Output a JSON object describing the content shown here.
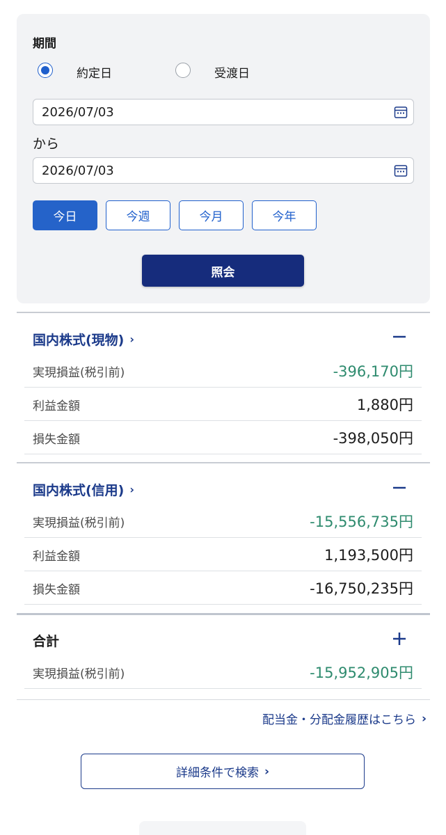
{
  "filter": {
    "period_label": "期間",
    "radio_trade_date": "約定日",
    "radio_delivery_date": "受渡日",
    "date_from": "2026/07/03",
    "kara": "から",
    "date_to": "2026/07/03",
    "quick_today": "今日",
    "quick_week": "今週",
    "quick_month": "今月",
    "quick_year": "今年",
    "submit": "照会"
  },
  "sections": [
    {
      "title": "国内株式(現物)",
      "chevron": "›",
      "rows": [
        {
          "label": "実現損益(税引前)",
          "value": "-396,170円"
        },
        {
          "label": "利益金額",
          "value": "1,880円"
        },
        {
          "label": "損失金額",
          "value": "-398,050円"
        }
      ]
    },
    {
      "title": "国内株式(信用)",
      "chevron": "›",
      "rows": [
        {
          "label": "実現損益(税引前)",
          "value": "-15,556,735円"
        },
        {
          "label": "利益金額",
          "value": "1,193,500円"
        },
        {
          "label": "損失金額",
          "value": "-16,750,235円"
        }
      ]
    },
    {
      "title": "合計",
      "rows": [
        {
          "label": "実現損益(税引前)",
          "value": "-15,952,905円"
        }
      ]
    }
  ],
  "links": {
    "dividend_history": "配当金・分配金履歴はこちら",
    "detail_search": "詳細条件で検索",
    "chevron": "›"
  },
  "colors": {
    "accent_blue": "#1f5fcc",
    "navy": "#162c7c",
    "loss_green": "#2e8b6e"
  }
}
